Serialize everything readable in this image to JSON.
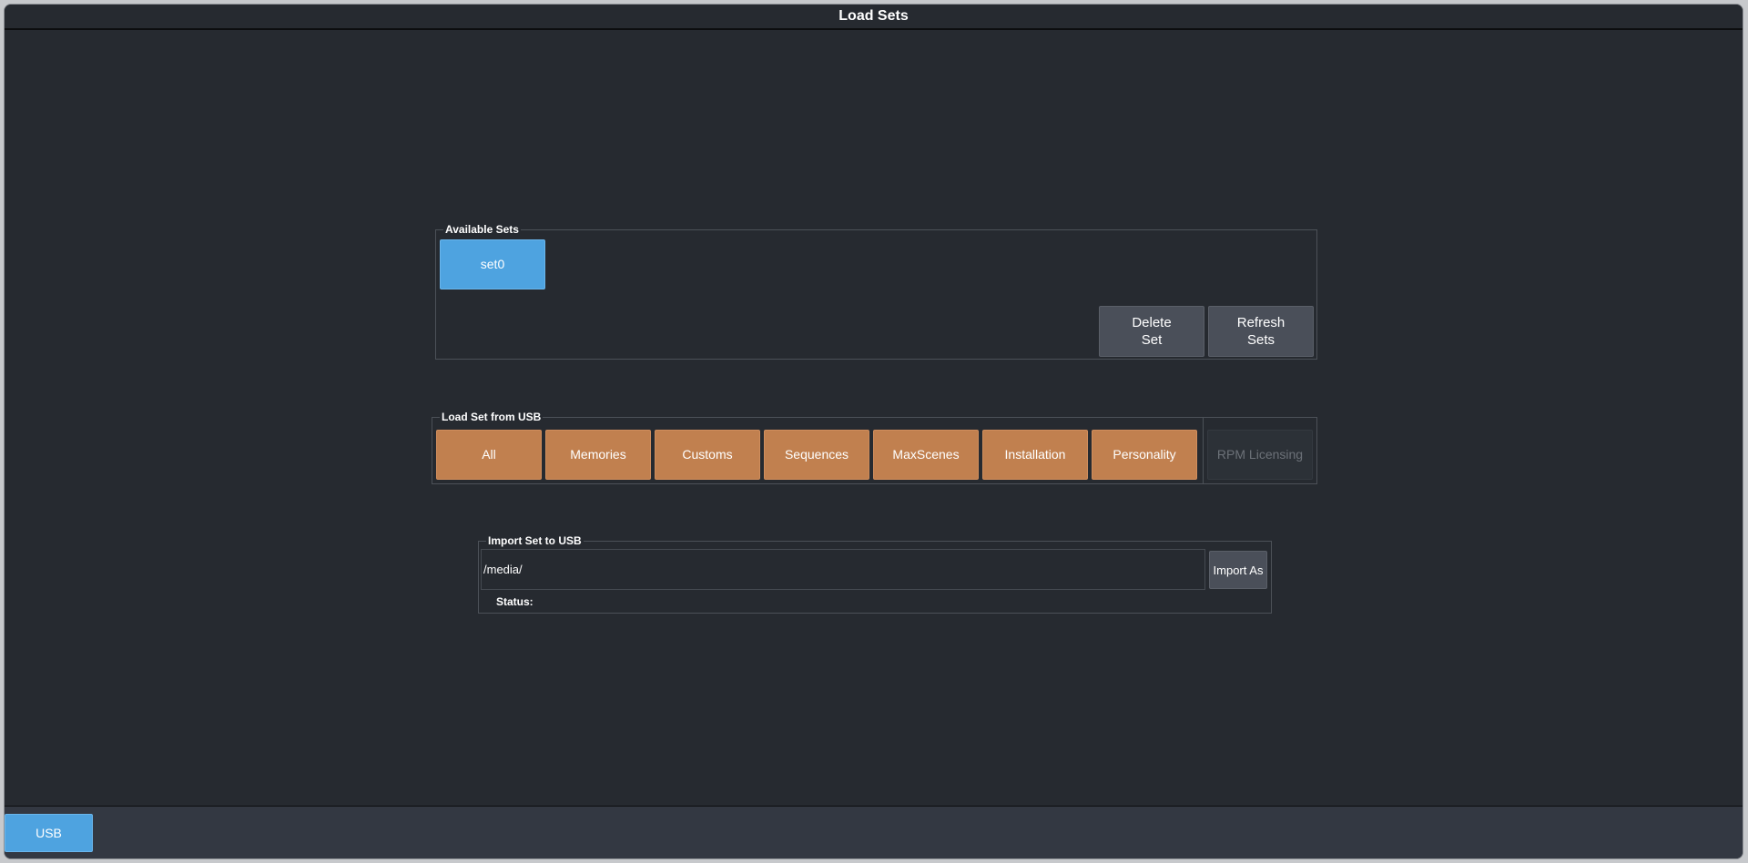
{
  "window": {
    "title": "Load Sets"
  },
  "available_sets": {
    "label": "Available Sets",
    "sets": [
      "set0"
    ],
    "delete_label": "Delete\nSet",
    "refresh_label": "Refresh\nSets"
  },
  "load_usb": {
    "label": "Load Set from USB",
    "buttons": [
      "All",
      "Memories",
      "Customs",
      "Sequences",
      "MaxScenes",
      "Installation",
      "Personality"
    ],
    "rpm_label": "RPM Licensing"
  },
  "import_usb": {
    "label": "Import Set to USB",
    "path_value": "/media/",
    "import_label": "Import As",
    "status_label": "Status:"
  },
  "footer": {
    "usb_label": "USB"
  },
  "colors": {
    "background": "#262a30",
    "accent_blue": "#4ea3e0",
    "load_orange": "#c1804f",
    "button_gray": "#4a4f59"
  }
}
